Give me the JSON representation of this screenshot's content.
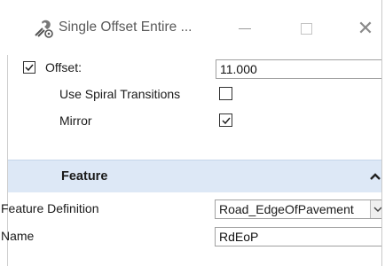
{
  "window": {
    "title": "Single Offset Entire ...",
    "icon": "civil-tool-icon",
    "controls": {
      "minimize": "minimize-icon",
      "maximize": "maximize-icon",
      "close": "close-icon",
      "close_glyph": "✕"
    }
  },
  "fields": {
    "offset": {
      "label": "Offset:",
      "checked": true,
      "value": "11.000"
    },
    "use_spiral": {
      "label": "Use Spiral Transitions",
      "checked": false
    },
    "mirror": {
      "label": "Mirror",
      "checked": true
    }
  },
  "feature_group": {
    "title": "Feature",
    "expanded": true,
    "feature_definition": {
      "label": "Feature Definition",
      "value": "Road_EdgeOfPavement"
    },
    "name": {
      "label": "Name",
      "value": "RdEoP"
    }
  },
  "colors": {
    "group_header_bg": "#dde8f6",
    "border": "#a0a0a0"
  }
}
